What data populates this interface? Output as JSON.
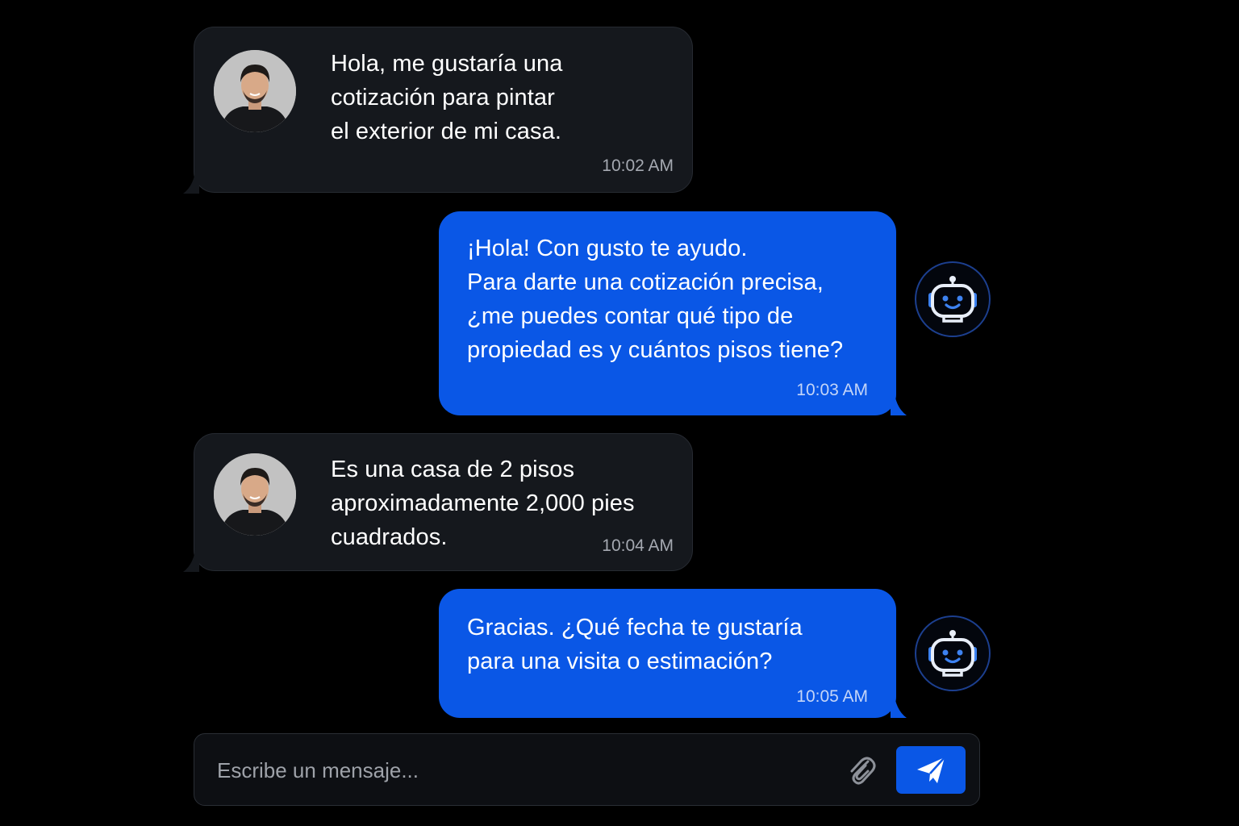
{
  "conversation": {
    "messages": [
      {
        "sender": "user",
        "text": "Hola, me gustaría una\ncotización para pintar\nel exterior de mi casa.",
        "time": "10:02 AM",
        "avatar": "user-photo"
      },
      {
        "sender": "bot",
        "text": "¡Hola! Con gusto te ayudo.\nPara darte una cotización precisa,\n¿me puedes contar qué tipo de\npropiedad es y cuántos pisos tiene?",
        "time": "10:03 AM",
        "avatar": "robot-icon"
      },
      {
        "sender": "user",
        "text": "Es una casa de 2 pisos\naproximadamente 2,000 pies\ncuadrados.",
        "time": "10:04 AM",
        "avatar": "user-photo"
      },
      {
        "sender": "bot",
        "text": "Gracias. ¿Qué fecha te gustaría\npara una visita o estimación?",
        "time": "10:05 AM",
        "avatar": "robot-icon"
      }
    ]
  },
  "composer": {
    "placeholder": "Escribe un mensaje...",
    "attach_icon": "paperclip-icon",
    "send_icon": "paper-plane-icon"
  },
  "colors": {
    "background": "#000000",
    "user_bubble": "#15181d",
    "bot_bubble": "#0a57e6",
    "send_button": "#0a57e6",
    "bot_avatar_ring": "#1c3f8f"
  }
}
